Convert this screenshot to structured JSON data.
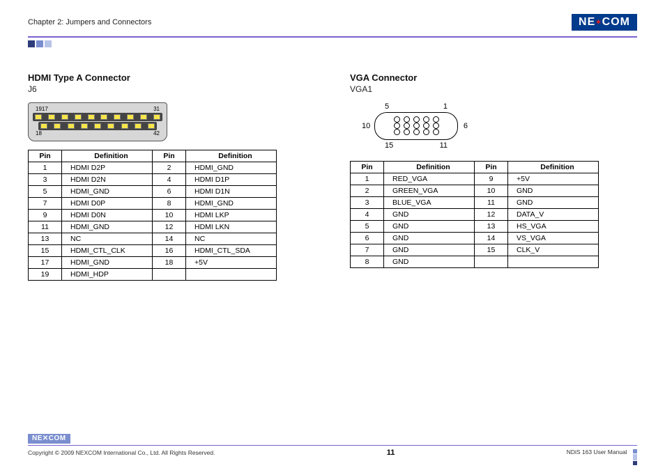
{
  "header": {
    "chapter": "Chapter 2: Jumpers and Connectors",
    "logo_text_1": "NE",
    "logo_text_2": "COM"
  },
  "hdmi": {
    "title": "HDMI Type A Connector",
    "sub": "J6",
    "diagram": {
      "top_left": "19",
      "top_l2": "17",
      "top_r2": "3",
      "top_right": "1",
      "bot_left": "18",
      "bot_r2": "4",
      "bot_right": "2"
    },
    "table_headers": {
      "pin": "Pin",
      "def": "Definition"
    },
    "rows": [
      {
        "p1": "1",
        "d1": "HDMI D2P",
        "p2": "2",
        "d2": "HDMI_GND"
      },
      {
        "p1": "3",
        "d1": "HDMI D2N",
        "p2": "4",
        "d2": "HDMI D1P"
      },
      {
        "p1": "5",
        "d1": "HDMI_GND",
        "p2": "6",
        "d2": "HDMI D1N"
      },
      {
        "p1": "7",
        "d1": "HDMI D0P",
        "p2": "8",
        "d2": "HDMI_GND"
      },
      {
        "p1": "9",
        "d1": "HDMI D0N",
        "p2": "10",
        "d2": "HDMI LKP"
      },
      {
        "p1": "11",
        "d1": "HDMI_GND",
        "p2": "12",
        "d2": "HDMI LKN"
      },
      {
        "p1": "13",
        "d1": "NC",
        "p2": "14",
        "d2": "NC"
      },
      {
        "p1": "15",
        "d1": "HDMI_CTL_CLK",
        "p2": "16",
        "d2": "HDMI_CTL_SDA"
      },
      {
        "p1": "17",
        "d1": "HDMI_GND",
        "p2": "18",
        "d2": "+5V"
      },
      {
        "p1": "19",
        "d1": "HDMI_HDP",
        "p2": "",
        "d2": ""
      }
    ]
  },
  "vga": {
    "title": "VGA Connector",
    "sub": "VGA1",
    "diagram": {
      "top_left": "5",
      "top_right": "1",
      "mid_left": "10",
      "mid_right": "6",
      "bot_left": "15",
      "bot_right": "11"
    },
    "table_headers": {
      "pin": "Pin",
      "def": "Definition"
    },
    "rows": [
      {
        "p1": "1",
        "d1": "RED_VGA",
        "p2": "9",
        "d2": "+5V"
      },
      {
        "p1": "2",
        "d1": "GREEN_VGA",
        "p2": "10",
        "d2": "GND"
      },
      {
        "p1": "3",
        "d1": "BLUE_VGA",
        "p2": "11",
        "d2": "GND"
      },
      {
        "p1": "4",
        "d1": "GND",
        "p2": "12",
        "d2": "DATA_V"
      },
      {
        "p1": "5",
        "d1": "GND",
        "p2": "13",
        "d2": "HS_VGA"
      },
      {
        "p1": "6",
        "d1": "GND",
        "p2": "14",
        "d2": "VS_VGA"
      },
      {
        "p1": "7",
        "d1": "GND",
        "p2": "15",
        "d2": "CLK_V"
      },
      {
        "p1": "8",
        "d1": "GND",
        "p2": "",
        "d2": ""
      }
    ]
  },
  "footer": {
    "copyright": "Copyright © 2009 NEXCOM International Co., Ltd. All Rights Reserved.",
    "page": "11",
    "manual": "NDiS 163 User Manual",
    "logo_text_1": "NE",
    "logo_text_2": "COM"
  }
}
